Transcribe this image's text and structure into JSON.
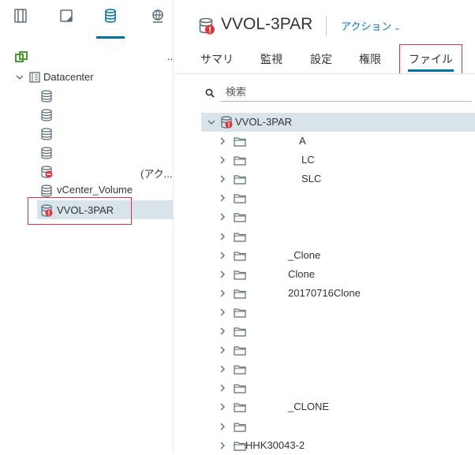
{
  "left_nav": {
    "tabs": [
      {
        "name": "hosts-clusters",
        "icon": "hosts-icon"
      },
      {
        "name": "vms-templates",
        "icon": "vm-icon"
      },
      {
        "name": "storage",
        "icon": "database-icon",
        "selected": true
      },
      {
        "name": "networking",
        "icon": "network-icon"
      }
    ],
    "more_label": "..",
    "datacenter_label": "Datacenter",
    "datastores": [
      {
        "label": "",
        "state": "normal"
      },
      {
        "label": "",
        "state": "normal"
      },
      {
        "label": "",
        "state": "normal"
      },
      {
        "label": "",
        "state": "normal"
      },
      {
        "label": "(アク...",
        "state": "error"
      },
      {
        "label": "vCenter_Volume",
        "state": "normal"
      },
      {
        "label": "VVOL-3PAR",
        "state": "error",
        "selected": true
      }
    ]
  },
  "header": {
    "title": "VVOL-3PAR",
    "actions_label": "アクション",
    "actions_caret": "⌄"
  },
  "tabs": [
    {
      "label": "サマリ"
    },
    {
      "label": "監視"
    },
    {
      "label": "設定"
    },
    {
      "label": "権限"
    },
    {
      "label": "ファイル",
      "active": true
    }
  ],
  "search": {
    "placeholder": "検索",
    "value": ""
  },
  "file_tree": {
    "root": {
      "label": "VVOL-3PAR",
      "expanded": true
    },
    "folders": [
      {
        "label": "A"
      },
      {
        "label": "LC"
      },
      {
        "label": "SLC"
      },
      {
        "label": ""
      },
      {
        "label": ""
      },
      {
        "label": ""
      },
      {
        "label": "_Clone"
      },
      {
        "label": "Clone"
      },
      {
        "label": "20170716Clone"
      },
      {
        "label": ""
      },
      {
        "label": ""
      },
      {
        "label": ""
      },
      {
        "label": ""
      },
      {
        "label": ""
      },
      {
        "label": "_CLONE"
      },
      {
        "label": ""
      },
      {
        "label": "HHK30043-2"
      }
    ]
  },
  "colors": {
    "accent": "#0072a3",
    "link": "#0079b8",
    "error": "#e0353b",
    "selection": "#d8e3ea"
  }
}
